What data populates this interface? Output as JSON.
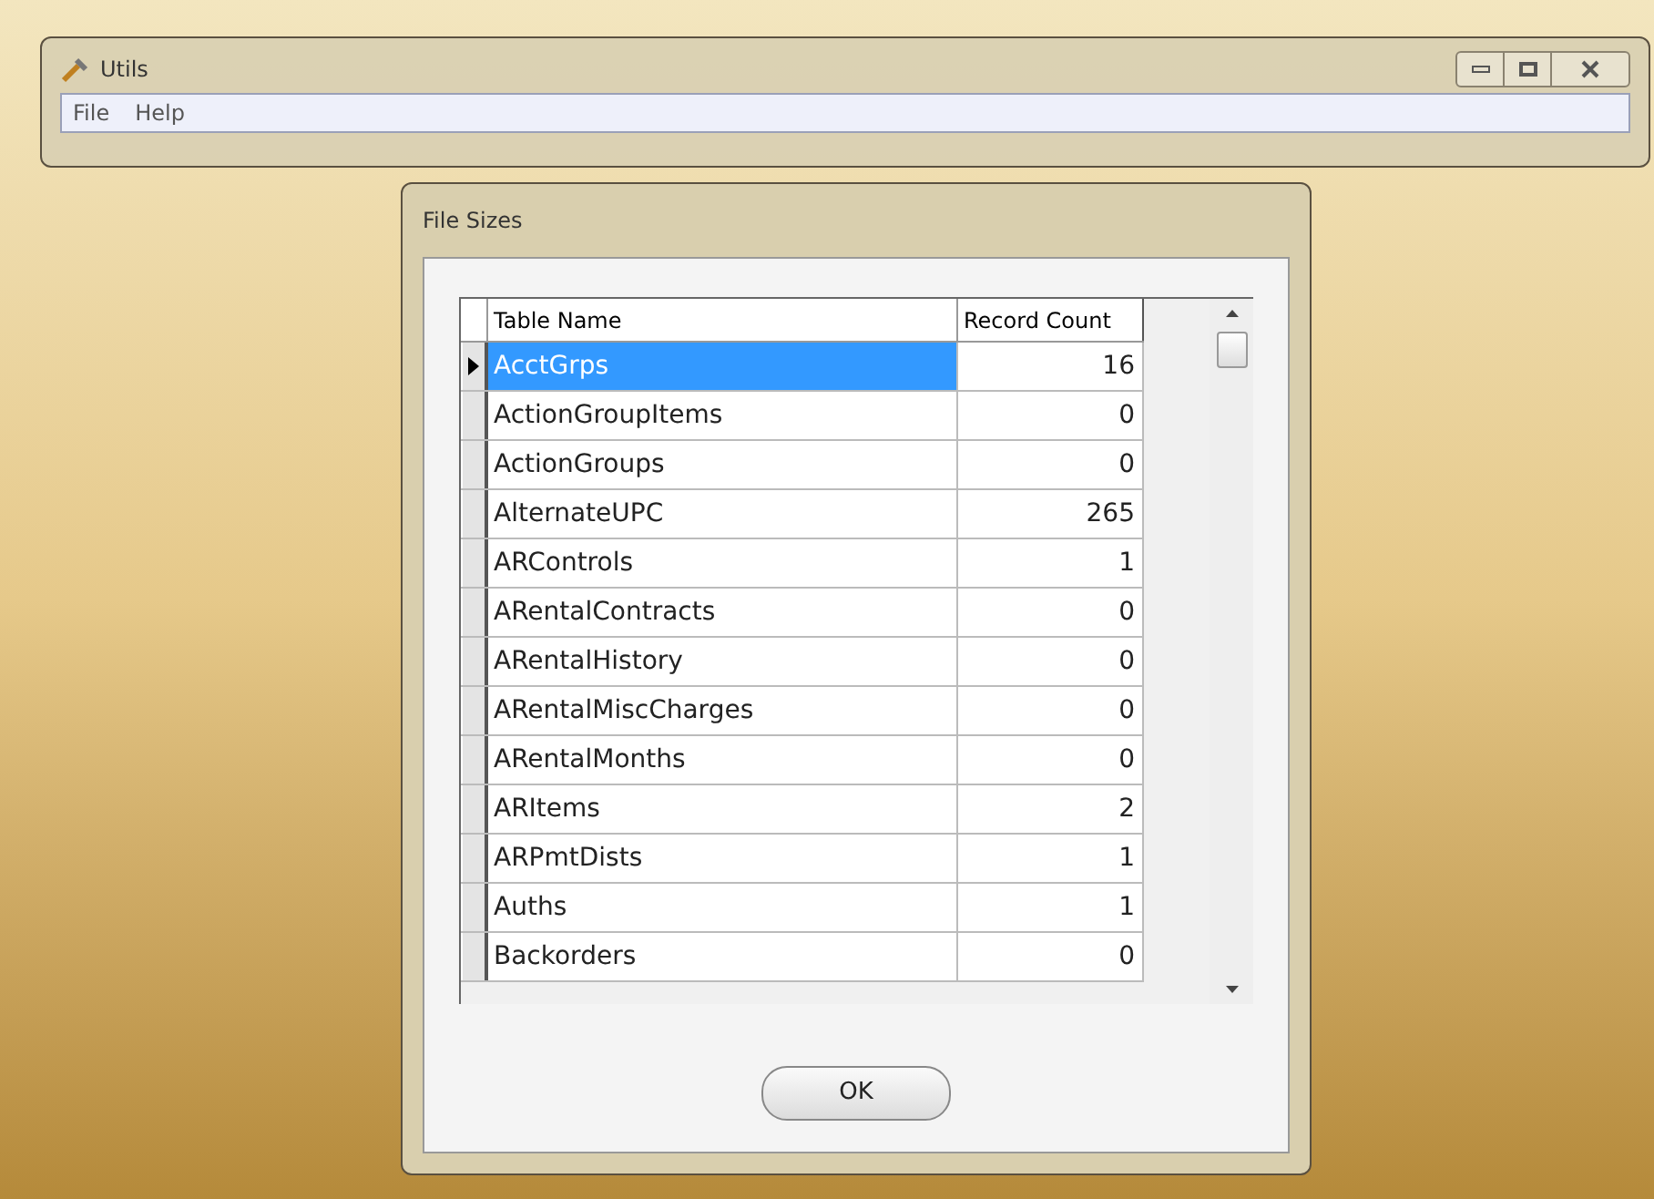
{
  "main_window": {
    "title": "Utils",
    "menu": [
      {
        "label": "File"
      },
      {
        "label": "Help"
      }
    ]
  },
  "dialog": {
    "title": "File Sizes",
    "table": {
      "columns": [
        "Table Name",
        "Record Count"
      ],
      "rows": [
        {
          "name": "AcctGrps",
          "count": "16",
          "selected": true
        },
        {
          "name": "ActionGroupItems",
          "count": "0",
          "selected": false
        },
        {
          "name": "ActionGroups",
          "count": "0",
          "selected": false
        },
        {
          "name": "AlternateUPC",
          "count": "265",
          "selected": false
        },
        {
          "name": "ARControls",
          "count": "1",
          "selected": false
        },
        {
          "name": "ARentalContracts",
          "count": "0",
          "selected": false
        },
        {
          "name": "ARentalHistory",
          "count": "0",
          "selected": false
        },
        {
          "name": "ARentalMiscCharges",
          "count": "0",
          "selected": false
        },
        {
          "name": "ARentalMonths",
          "count": "0",
          "selected": false
        },
        {
          "name": "ARItems",
          "count": "2",
          "selected": false
        },
        {
          "name": "ARPmtDists",
          "count": "1",
          "selected": false
        },
        {
          "name": "Auths",
          "count": "1",
          "selected": false
        },
        {
          "name": "Backorders",
          "count": "0",
          "selected": false
        }
      ]
    },
    "ok_button": "OK"
  }
}
